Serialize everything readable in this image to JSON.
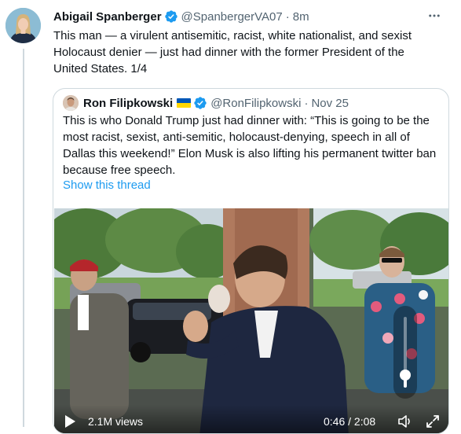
{
  "tweet": {
    "author_name": "Abigail Spanberger",
    "handle": "@SpanbergerVA07",
    "separator": "·",
    "time": "8m",
    "text": "This man — a virulent antisemitic, racist, white nationalist, and sexist Holocaust denier — just had dinner with the former President of the United States. 1/4"
  },
  "quote": {
    "author_name": "Ron Filipkowski",
    "handle": "@RonFilipkowski",
    "separator": "·",
    "date": "Nov 25",
    "text": "This is who Donald Trump just had dinner with: “This is going to be the most racist, sexist, anti-semitic, holocaust-denying, speech in all of Dallas this weekend!” Elon Musk is also lifting his permanent twitter ban because free speech.",
    "show_thread": "Show this thread"
  },
  "video": {
    "views": "2.1M views",
    "time": "0:46 / 2:08",
    "volume_level": 0.18,
    "progress_fraction": 0.37
  },
  "icons": {
    "verified": "verified-badge-icon",
    "flag": "ukraine-flag-icon",
    "more": "more-horizontal-icon",
    "play": "play-icon",
    "volume": "volume-icon",
    "fullscreen": "fullscreen-icon"
  },
  "colors": {
    "accent": "#1d9bf0",
    "text": "#0f1419",
    "muted": "#536471",
    "border": "#cfd9de"
  }
}
